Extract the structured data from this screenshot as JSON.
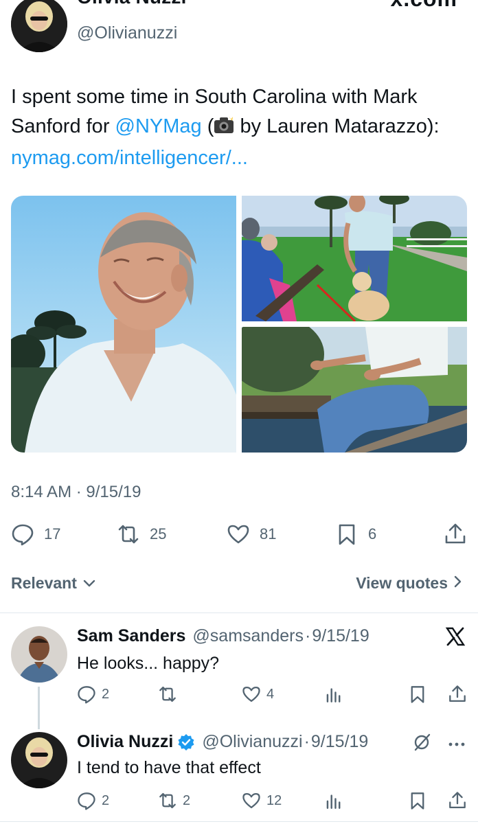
{
  "tweet": {
    "author_name": "Olivia Nuzzi",
    "author_handle": "@Olivianuzzi",
    "source_site": "x.com",
    "text_1": "I spent some time in South Carolina with Mark Sanford for ",
    "mention": "@NYMag",
    "text_2": " (",
    "camera_icon": "camera-flash-icon",
    "text_3": " by Lauren Matarazzo): ",
    "link": "nymag.com/intelligencer/...",
    "timestamp": "8:14 AM · 9/15/19",
    "replies": "17",
    "retweets": "25",
    "likes": "81",
    "bookmarks": "6"
  },
  "sort": {
    "label": "Relevant",
    "quotes_label": "View quotes"
  },
  "replies": [
    {
      "name": "Sam Sanders",
      "handle": "@samsanders",
      "separator": "·",
      "date": "9/15/19",
      "text": "He looks... happy?",
      "reply_count": "2",
      "retweet_count": "",
      "like_count": "4"
    },
    {
      "name": "Olivia Nuzzi",
      "handle": "@Olivianuzzi",
      "separator": "·",
      "date": "9/15/19",
      "text": "I tend to have that effect",
      "reply_count": "2",
      "retweet_count": "2",
      "like_count": "12"
    }
  ],
  "colors": {
    "link": "#1d9bf0",
    "muted": "#536471",
    "text": "#0f1419",
    "verified": "#1d9bf0"
  }
}
